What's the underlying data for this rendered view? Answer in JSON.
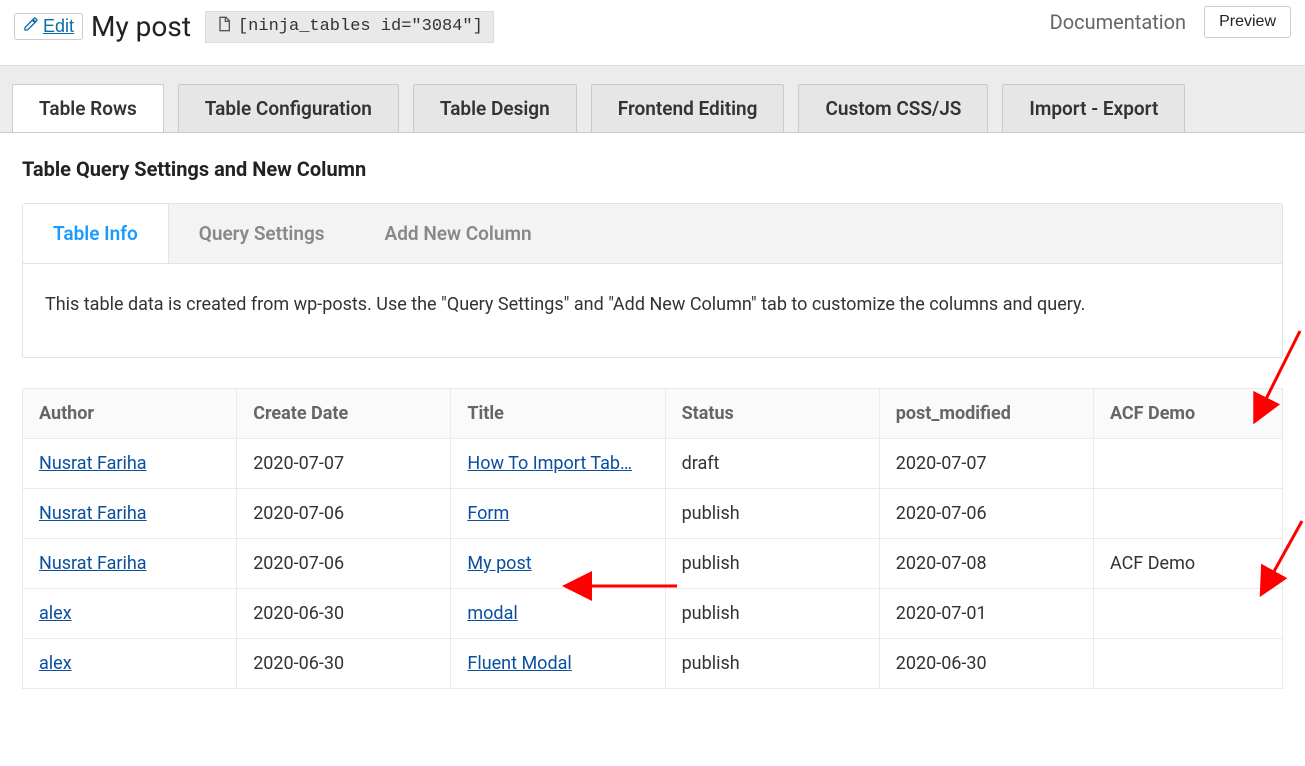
{
  "header": {
    "edit_label": "Edit",
    "title": "My post",
    "shortcode": "[ninja_tables id=\"3084\"]",
    "documentation_label": "Documentation",
    "preview_label": "Preview"
  },
  "main_tabs": [
    {
      "label": "Table Rows",
      "active": true
    },
    {
      "label": "Table Configuration",
      "active": false
    },
    {
      "label": "Table Design",
      "active": false
    },
    {
      "label": "Frontend Editing",
      "active": false
    },
    {
      "label": "Custom CSS/JS",
      "active": false
    },
    {
      "label": "Import - Export",
      "active": false
    }
  ],
  "section_title": "Table Query Settings and New Column",
  "sub_tabs": [
    {
      "label": "Table Info",
      "active": true
    },
    {
      "label": "Query Settings",
      "active": false
    },
    {
      "label": "Add New Column",
      "active": false
    }
  ],
  "info_text": "This table data is created from wp-posts. Use the \"Query Settings\" and \"Add New Column\" tab to customize the columns and query.",
  "columns": [
    "Author",
    "Create Date",
    "Title",
    "Status",
    "post_modified",
    "ACF Demo"
  ],
  "rows": [
    {
      "author": "Nusrat Fariha",
      "create_date": "2020-07-07",
      "title": "How To Import Tab…",
      "status": "draft",
      "post_modified": "2020-07-07",
      "acf_demo": ""
    },
    {
      "author": "Nusrat Fariha",
      "create_date": "2020-07-06",
      "title": "Form",
      "status": "publish",
      "post_modified": "2020-07-06",
      "acf_demo": ""
    },
    {
      "author": "Nusrat Fariha",
      "create_date": "2020-07-06",
      "title": "My post",
      "status": "publish",
      "post_modified": "2020-07-08",
      "acf_demo": "ACF Demo"
    },
    {
      "author": "alex",
      "create_date": "2020-06-30",
      "title": "modal",
      "status": "publish",
      "post_modified": "2020-07-01",
      "acf_demo": ""
    },
    {
      "author": "alex",
      "create_date": "2020-06-30",
      "title": "Fluent Modal",
      "status": "publish",
      "post_modified": "2020-06-30",
      "acf_demo": ""
    }
  ]
}
